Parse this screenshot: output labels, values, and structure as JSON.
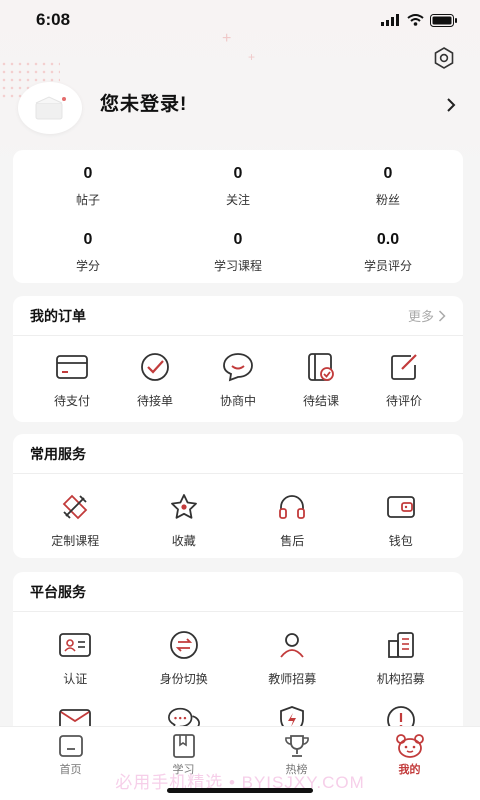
{
  "status": {
    "time": "6:08"
  },
  "profile": {
    "login_text": "您未登录!"
  },
  "stats": [
    {
      "value": "0",
      "label": "帖子"
    },
    {
      "value": "0",
      "label": "关注"
    },
    {
      "value": "0",
      "label": "粉丝"
    },
    {
      "value": "0",
      "label": "学分"
    },
    {
      "value": "0",
      "label": "学习课程"
    },
    {
      "value": "0.0",
      "label": "学员评分"
    }
  ],
  "orders": {
    "title": "我的订单",
    "more": "更多",
    "items": [
      {
        "label": "待支付",
        "icon": "card-icon"
      },
      {
        "label": "待接单",
        "icon": "check-circle-icon"
      },
      {
        "label": "协商中",
        "icon": "chat-icon"
      },
      {
        "label": "待结课",
        "icon": "book-check-icon"
      },
      {
        "label": "待评价",
        "icon": "edit-icon"
      }
    ]
  },
  "common": {
    "title": "常用服务",
    "items": [
      {
        "label": "定制课程",
        "icon": "pencil-ruler-icon"
      },
      {
        "label": "收藏",
        "icon": "star-icon"
      },
      {
        "label": "售后",
        "icon": "headphones-icon"
      },
      {
        "label": "钱包",
        "icon": "wallet-icon"
      }
    ]
  },
  "platform": {
    "title": "平台服务",
    "items": [
      {
        "label": "认证",
        "icon": "id-card-icon"
      },
      {
        "label": "身份切换",
        "icon": "swap-icon"
      },
      {
        "label": "教师招募",
        "icon": "user-icon"
      },
      {
        "label": "机构招募",
        "icon": "building-icon"
      },
      {
        "label": "",
        "icon": "mail-icon"
      },
      {
        "label": "",
        "icon": "messages-icon"
      },
      {
        "label": "",
        "icon": "shield-icon"
      },
      {
        "label": "",
        "icon": "alert-icon"
      }
    ]
  },
  "tabbar": {
    "items": [
      {
        "label": "首页",
        "icon": "home-icon",
        "active": false
      },
      {
        "label": "学习",
        "icon": "book-icon",
        "active": false
      },
      {
        "label": "热榜",
        "icon": "trophy-icon",
        "active": false
      },
      {
        "label": "我的",
        "icon": "bear-icon",
        "active": true
      }
    ]
  },
  "watermark": "必用手机精选 • BYISJXY.COM",
  "colors": {
    "accent": "#c23b3b",
    "icon_dark": "#333333"
  }
}
